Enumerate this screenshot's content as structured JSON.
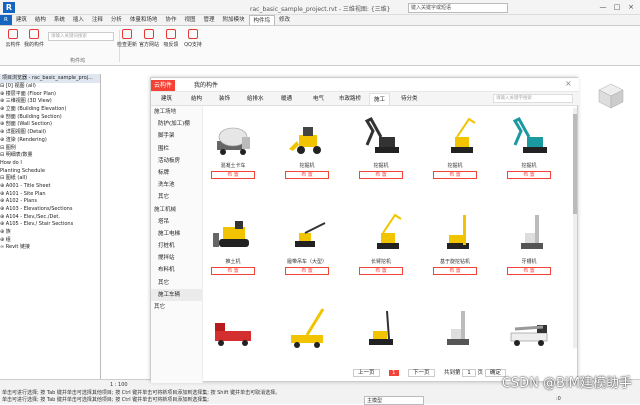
{
  "app": {
    "title": "rac_basic_sample_project.rvt - 三维视图: {三维}",
    "search_placeholder": "键入关键字或短语",
    "controls": [
      "—",
      "□",
      "×"
    ]
  },
  "ribbon_tabs": [
    "R",
    "建筑",
    "结构",
    "系统",
    "插入",
    "注释",
    "分析",
    "体量和场地",
    "协作",
    "视图",
    "管理",
    "附加模块",
    "构件坞",
    "修改"
  ],
  "ribbon_active_tab": "构件坞",
  "ribbon": {
    "left_buttons": [
      {
        "label": "云构件"
      },
      {
        "label": "我的构件"
      }
    ],
    "search_placeholder": "请输入关键词搜索",
    "right_buttons": [
      {
        "label": "检查更新"
      },
      {
        "label": "官方网站"
      },
      {
        "label": "吸反馈"
      },
      {
        "label": "QQ支持"
      }
    ],
    "group_label": "构件坞"
  },
  "project_browser": {
    "header": "项目浏览器 - rac_basic_sample_proj...",
    "tree": [
      "⊟ [0] 视图 (all)",
      "   ⊕ 楼层平面 (Floor Plan)",
      "   ⊕ 三维视图 (3D View)",
      "   ⊕ 立面 (Building Elevation)",
      "   ⊕ 剖面 (Building Section)",
      "   ⊕ 剖面 (Wall Section)",
      "   ⊕ 详图视图 (Detail)",
      "   ⊕ 渲染 (Rendering)",
      "⊟ 图例",
      "⊟ 明细表/数量",
      "      How do I",
      "      Planting Schedule",
      "⊟ 图纸 (all)",
      "   ⊕ A001 - Title Sheet",
      "   ⊕ A101 - Site Plan",
      "   ⊕ A102 - Plans",
      "   ⊕ A103 - Elevations/Sections",
      "   ⊕ A104 - Elev./Sec./Det.",
      "   ⊕ A105 - Elev./ Stair Sections",
      "⊕ 族",
      "⊕ 组",
      "   ∞ Revit 链接"
    ]
  },
  "dialog": {
    "tabs": [
      "云构件",
      "我的构件"
    ],
    "active_tab": "云构件",
    "close": "×",
    "categories": [
      "建筑",
      "结构",
      "装饰",
      "给排水",
      "暖通",
      "电气",
      "市政路桥",
      "施工",
      "待分类"
    ],
    "active_category": "施工",
    "search_placeholder": "请输入关键字搜索",
    "sidebar": [
      {
        "label": "施工场地",
        "group": true
      },
      {
        "label": "防护(加工)棚",
        "group": false
      },
      {
        "label": "脚手架",
        "group": false
      },
      {
        "label": "围栏",
        "group": false
      },
      {
        "label": "活动板房",
        "group": false
      },
      {
        "label": "标牌",
        "group": false
      },
      {
        "label": "洗车池",
        "group": false
      },
      {
        "label": "其它",
        "group": false
      },
      {
        "label": "施工机械",
        "group": true
      },
      {
        "label": "塔吊",
        "group": false
      },
      {
        "label": "施工电梯",
        "group": false
      },
      {
        "label": "打桩机",
        "group": false
      },
      {
        "label": "搅拌站",
        "group": false
      },
      {
        "label": "布料机",
        "group": false
      },
      {
        "label": "其它",
        "group": false
      },
      {
        "label": "施工车辆",
        "group": false
      },
      {
        "label": "其它",
        "group": true
      }
    ],
    "active_sidebar": "施工车辆",
    "items": [
      {
        "name": "混凝土卡车",
        "load": "布 置",
        "icon": "mixer-truck-icon"
      },
      {
        "name": "挖掘机",
        "load": "布 置",
        "icon": "loader-icon"
      },
      {
        "name": "挖掘机",
        "load": "布 置",
        "icon": "excavator-icon"
      },
      {
        "name": "挖掘机",
        "load": "布 置",
        "icon": "long-arm-excavator-icon"
      },
      {
        "name": "挖掘机",
        "load": "布 置",
        "icon": "excavator-icon"
      },
      {
        "name": "推土机",
        "load": "布 置",
        "icon": "bulldozer-icon"
      },
      {
        "name": "履带吊车（大型）",
        "load": "布 置",
        "icon": "crawler-crane-icon"
      },
      {
        "name": "长臂挖机",
        "load": "布 置",
        "icon": "long-arm-excavator-icon"
      },
      {
        "name": "基于旋挖钻机",
        "load": "布 置",
        "icon": "rotary-drill-icon"
      },
      {
        "name": "牙槽机",
        "load": "布 置",
        "icon": "drill-rig-icon"
      },
      {
        "name": "",
        "load": "",
        "icon": "fire-truck-icon"
      },
      {
        "name": "",
        "load": "",
        "icon": "mobile-crane-icon"
      },
      {
        "name": "",
        "load": "",
        "icon": "pile-driver-icon"
      },
      {
        "name": "",
        "load": "",
        "icon": "drill-rig-icon"
      },
      {
        "name": "",
        "load": "",
        "icon": "pump-truck-icon"
      }
    ],
    "pager": {
      "prev": "上一页",
      "current": "1",
      "next": "下一页",
      "total_label": "共到第",
      "page_box": "1",
      "page_unit": "页",
      "confirm": "确定"
    }
  },
  "statusbar": {
    "scale": "1 : 100",
    "hint_top": "单击可进行选择; 按 Tab 键并单击可选择其他项目; 按 Ctrl 键并单击可将新项目添加到选择集; 按 Shift 键并单击可取消选择。",
    "hint_bottom": "单击可进行选择; 按 Tab 键并单击可选择其他项目; 按 Ctrl 键并单击可将新项目添加到选择集;",
    "model": "主模型",
    "zero": ":0"
  },
  "watermark": "CSDN @BIM建模助手",
  "colors": {
    "accent": "#f44336",
    "machine_yellow": "#f2c400",
    "machine_teal": "#1a9aa0"
  }
}
